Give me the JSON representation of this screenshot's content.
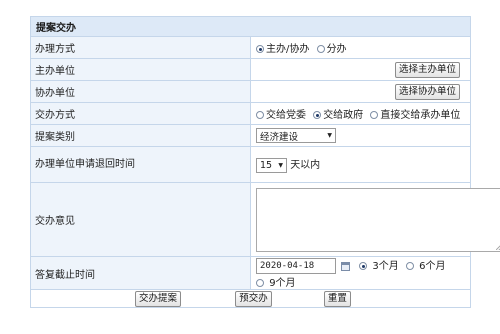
{
  "section": {
    "title": "提案交办"
  },
  "rows": {
    "handle_mode": {
      "label": "办理方式",
      "options": [
        "主办/协办",
        "分办"
      ],
      "selected": 0
    },
    "lead_unit": {
      "label": "主办单位",
      "button": "选择主办单位"
    },
    "assist_unit": {
      "label": "协办单位",
      "button": "选择协办单位"
    },
    "assign_mode": {
      "label": "交办方式",
      "options": [
        "交给党委",
        "交给政府",
        "直接交给承办单位"
      ],
      "selected": 1
    },
    "category": {
      "label": "提案类别",
      "value": "经济建设"
    },
    "return_time": {
      "label": "办理单位申请退回时间",
      "value": "15",
      "suffix": "天以内"
    },
    "opinion": {
      "label": "交办意见",
      "value": ""
    },
    "deadline": {
      "label": "答复截止时间",
      "date": "2020-04-18",
      "options": [
        "3个月",
        "6个月",
        "9个月"
      ],
      "selected": 0
    }
  },
  "footer": {
    "submit": "交办提案",
    "pre_assign": "预交办",
    "reset": "重置"
  }
}
